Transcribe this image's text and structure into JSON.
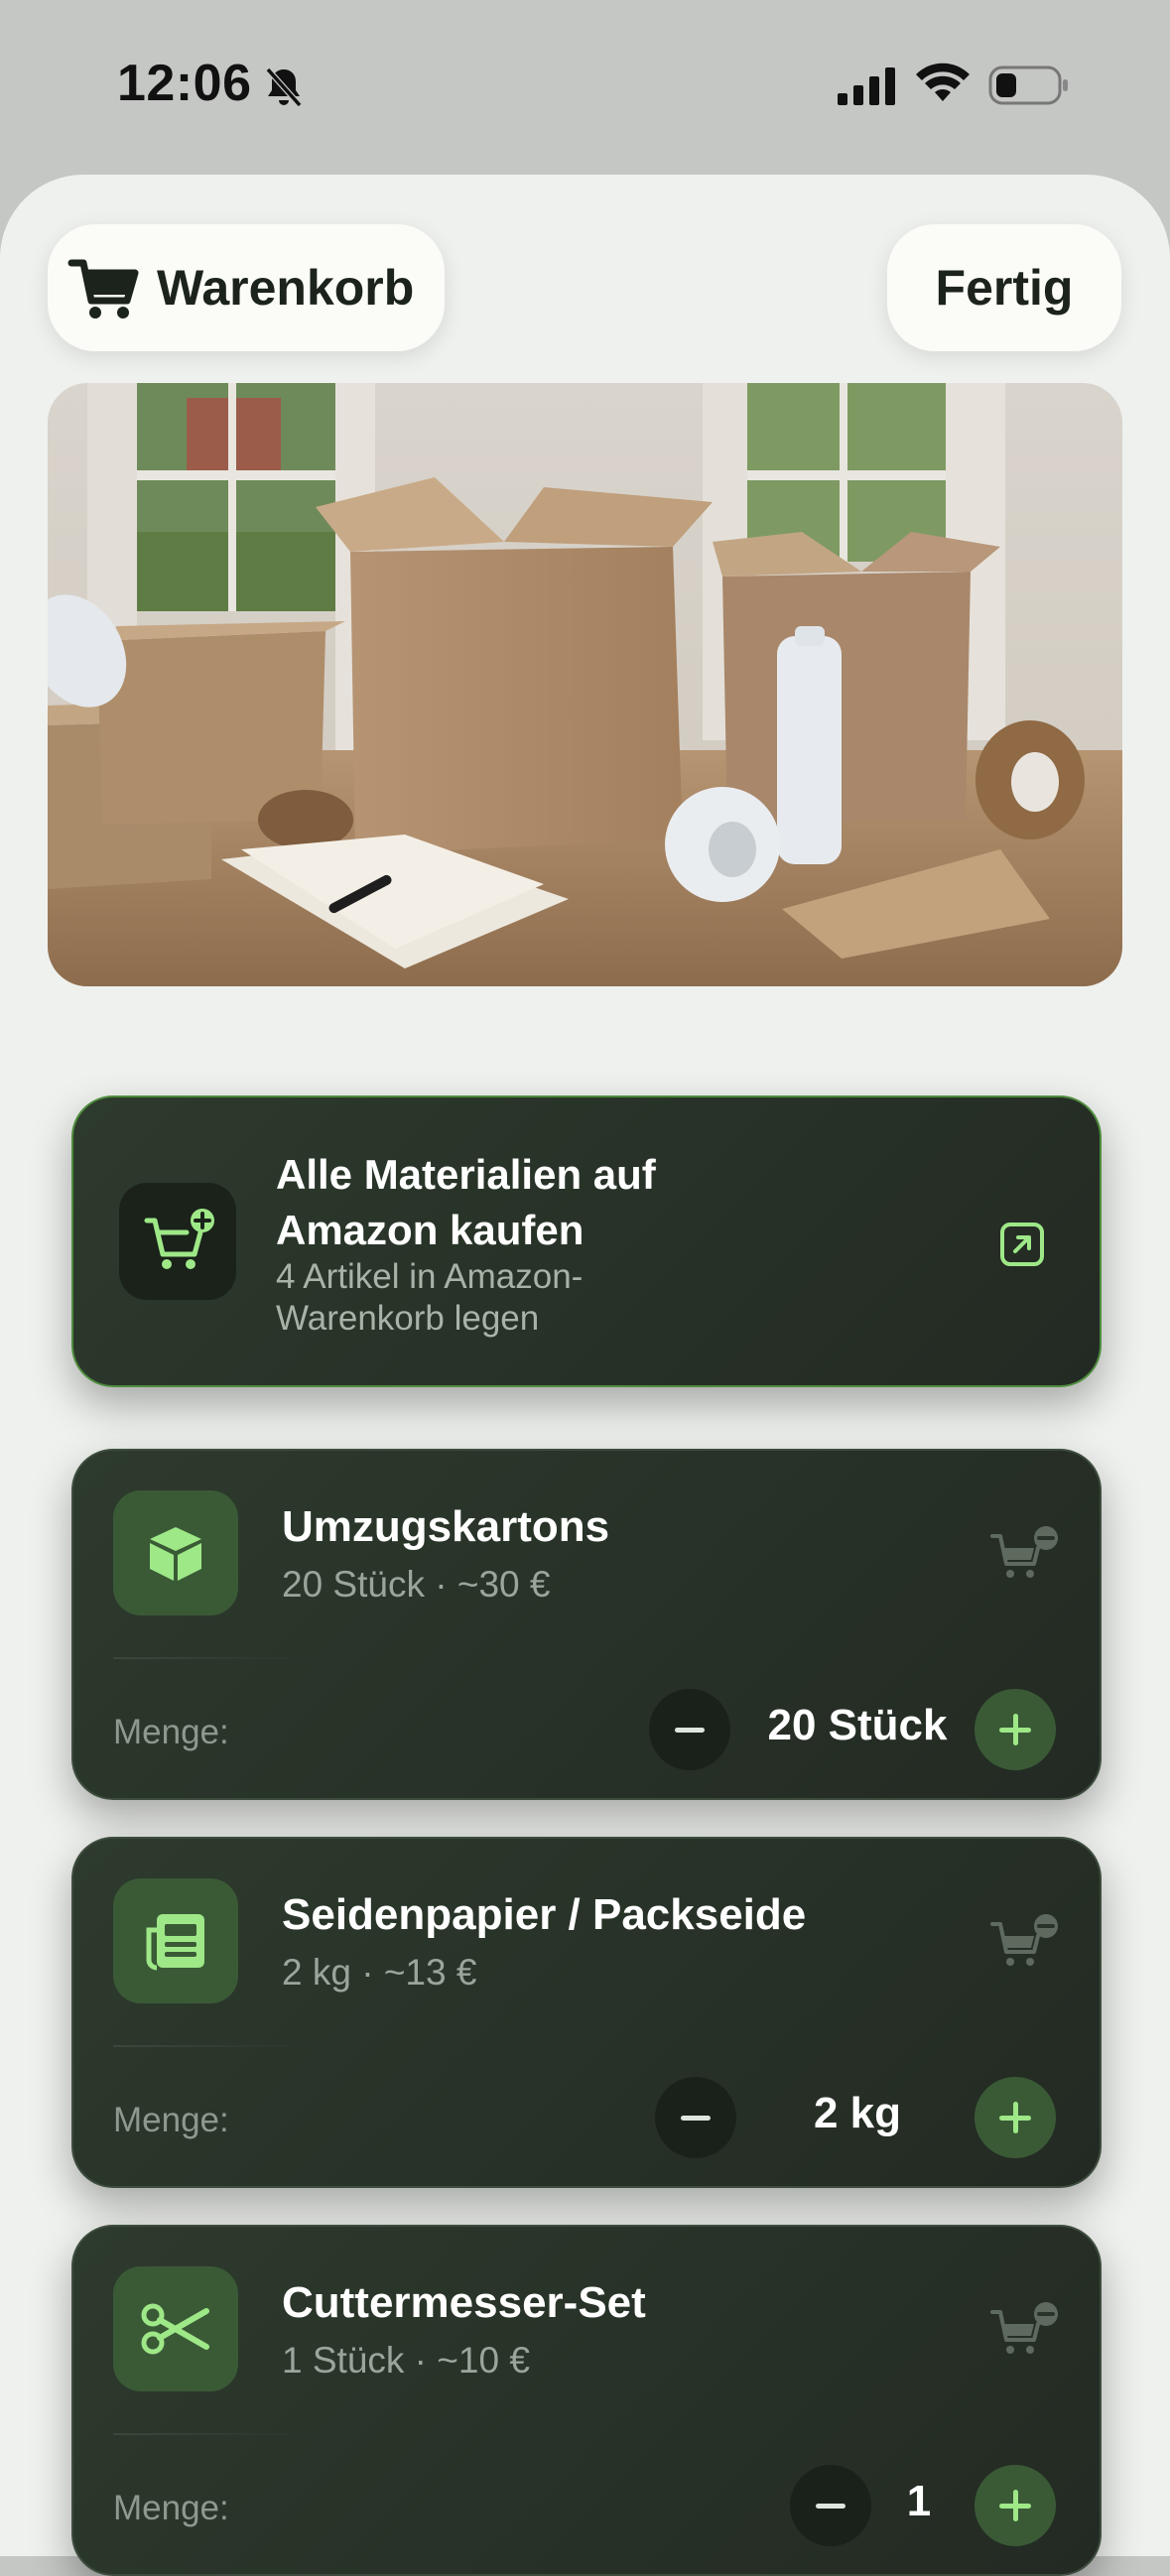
{
  "status_bar": {
    "time": "12:06"
  },
  "header": {
    "cart_title": "Warenkorb",
    "done_label": "Fertig"
  },
  "amazon_card": {
    "title": "Alle Materialien auf Amazon kaufen",
    "subtitle": "4 Artikel in Amazon-Warenkorb legen"
  },
  "items": [
    {
      "name": "Umzugskartons",
      "meta": "20 Stück · ~30 €",
      "qty_label": "Menge:",
      "qty": "20 Stück",
      "icon": "box-icon"
    },
    {
      "name": "Seidenpapier / Packseide",
      "meta": "2 kg · ~13 €",
      "qty_label": "Menge:",
      "qty": "2 kg",
      "icon": "newspaper-icon"
    },
    {
      "name": "Cuttermesser-Set",
      "meta": "1 Stück · ~10 €",
      "qty_label": "Menge:",
      "qty": "1",
      "icon": "scissors-icon"
    }
  ],
  "colors": {
    "accent": "#9ee887",
    "card": "#2a332a",
    "sheet": "#eff1ee"
  }
}
